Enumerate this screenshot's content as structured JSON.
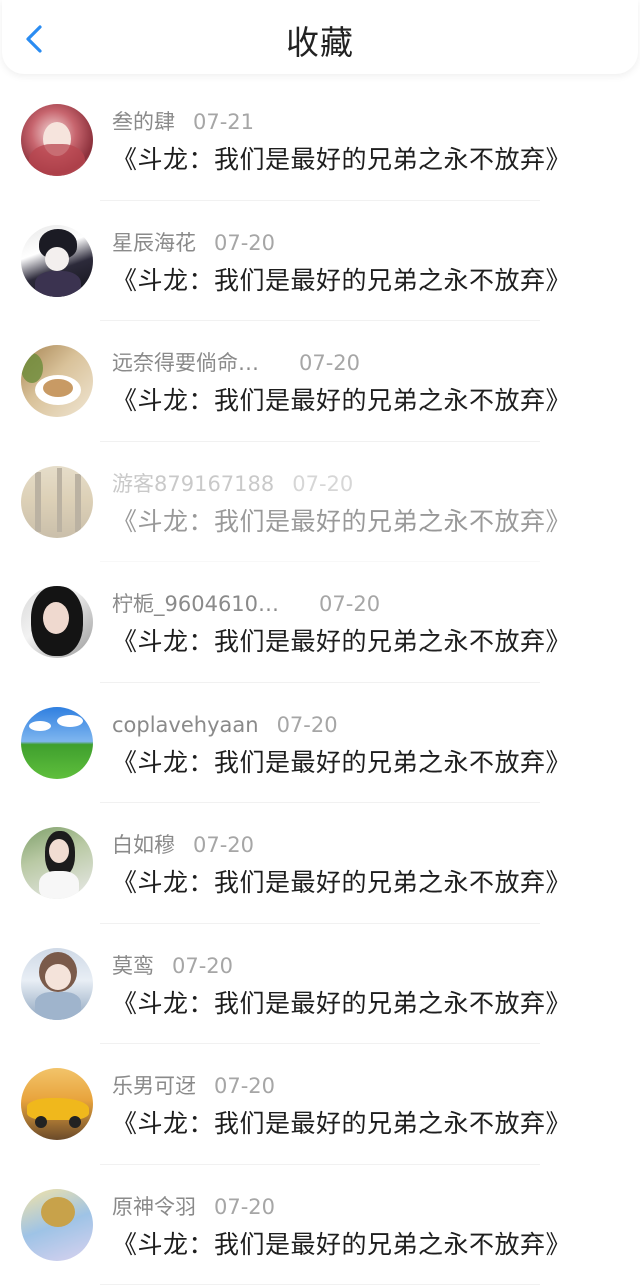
{
  "header": {
    "title": "收藏",
    "back_icon": "chevron-left-icon",
    "accent_color": "#2a8cf2"
  },
  "favorites": [
    {
      "name": "叁的肆",
      "date": "07-21",
      "book": "《斗龙：我们是最好的兄弟之永不放弃》"
    },
    {
      "name": "星辰海花",
      "date": "07-20",
      "book": "《斗龙：我们是最好的兄弟之永不放弃》"
    },
    {
      "name": "远奈得要倘命…",
      "date": "07-20",
      "book": "《斗龙：我们是最好的兄弟之永不放弃》"
    },
    {
      "name": "游客879167188",
      "date": "07-20",
      "book": "《斗龙：我们是最好的兄弟之永不放弃》"
    },
    {
      "name": "柠栀_9604610…",
      "date": "07-20",
      "book": "《斗龙：我们是最好的兄弟之永不放弃》"
    },
    {
      "name": "coplavehyaan",
      "date": "07-20",
      "book": "《斗龙：我们是最好的兄弟之永不放弃》"
    },
    {
      "name": "白如穆",
      "date": "07-20",
      "book": "《斗龙：我们是最好的兄弟之永不放弃》"
    },
    {
      "name": "莫鸾",
      "date": "07-20",
      "book": "《斗龙：我们是最好的兄弟之永不放弃》"
    },
    {
      "name": "乐男可迓",
      "date": "07-20",
      "book": "《斗龙：我们是最好的兄弟之永不放弃》"
    },
    {
      "name": "原神令羽",
      "date": "07-20",
      "book": "《斗龙：我们是最好的兄弟之永不放弃》"
    }
  ]
}
